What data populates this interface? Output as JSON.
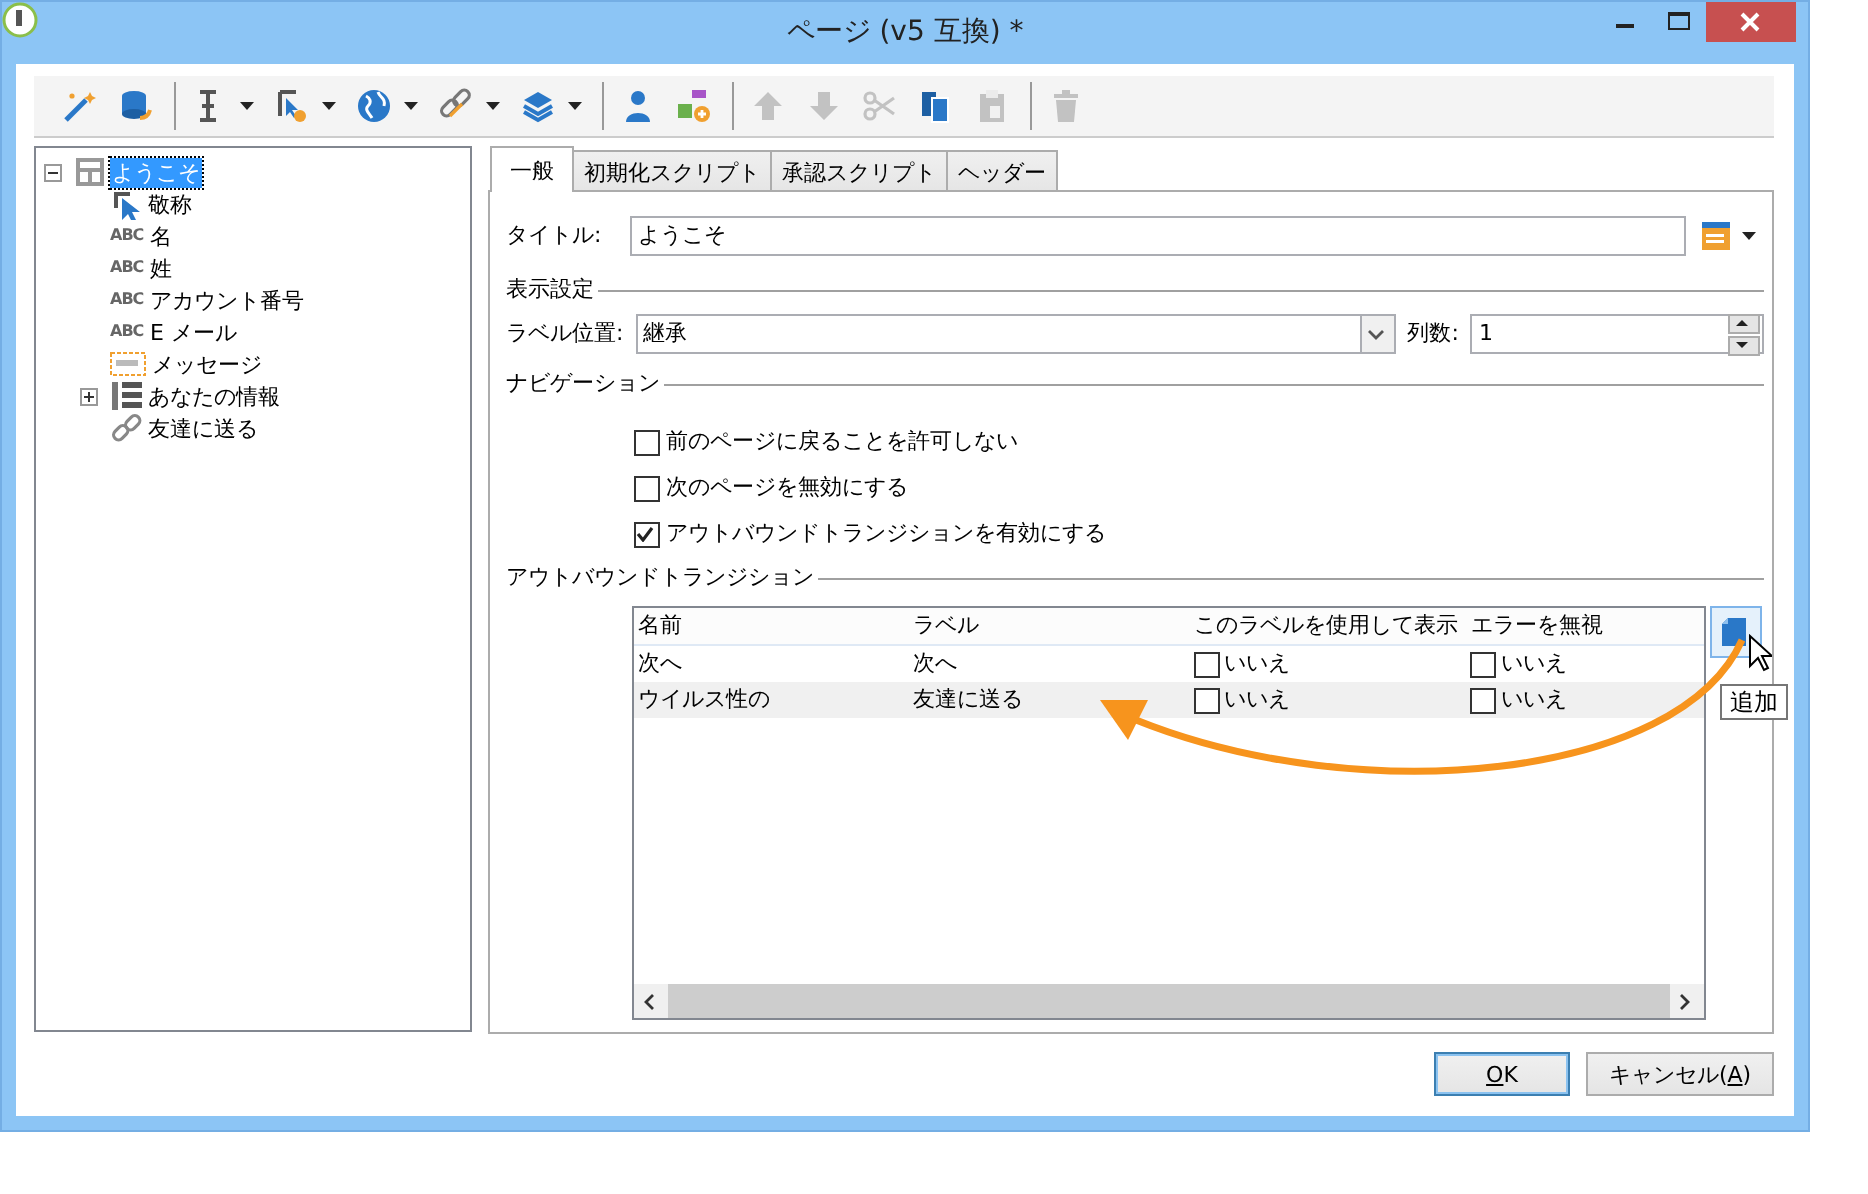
{
  "window": {
    "title": "ページ (v5 互換) *"
  },
  "toolbar": {
    "groups": [
      [
        {
          "dropdown": false,
          "disabled": false
        },
        {
          "dropdown": false,
          "disabled": false
        }
      ],
      [
        {
          "dropdown": true,
          "disabled": false
        },
        {
          "dropdown": true,
          "disabled": false
        },
        {
          "dropdown": true,
          "disabled": false
        },
        {
          "dropdown": true,
          "disabled": false
        },
        {
          "dropdown": true,
          "disabled": false
        }
      ],
      [
        {
          "dropdown": false,
          "disabled": false
        },
        {
          "dropdown": false,
          "disabled": false
        }
      ],
      [
        {
          "dropdown": false,
          "disabled": true
        },
        {
          "dropdown": false,
          "disabled": true
        },
        {
          "dropdown": false,
          "disabled": true
        },
        {
          "dropdown": false,
          "disabled": false
        },
        {
          "dropdown": false,
          "disabled": true
        }
      ],
      [
        {
          "dropdown": false,
          "disabled": true
        }
      ]
    ]
  },
  "tree": [
    {
      "label": "ようこそ",
      "kind": "page",
      "expanded": true,
      "selected": true,
      "children": [
        {
          "label": "敬称",
          "kind": "pointer",
          "selected": false
        },
        {
          "label": "名",
          "kind": "text",
          "badge": "ABC",
          "selected": false
        },
        {
          "label": "姓",
          "kind": "text",
          "badge": "ABC",
          "selected": false
        },
        {
          "label": "アカウント番号",
          "kind": "text",
          "badge": "ABC",
          "selected": false
        },
        {
          "label": "E メール",
          "kind": "text",
          "badge": "ABC",
          "selected": false
        },
        {
          "label": "メッセージ",
          "kind": "message",
          "selected": false
        },
        {
          "label": "あなたの情報",
          "kind": "group",
          "expanded": false,
          "selected": false
        },
        {
          "label": "友達に送る",
          "kind": "link",
          "selected": false
        }
      ]
    }
  ],
  "tabs": [
    {
      "label": "一般",
      "selected": true
    },
    {
      "label": "初期化スクリプト",
      "selected": false
    },
    {
      "label": "承認スクリプト",
      "selected": false
    },
    {
      "label": "ヘッダー",
      "selected": false
    }
  ],
  "form": {
    "title_label": "タイトル:",
    "title_value": "ようこそ",
    "display_section": "表示設定",
    "label_position_label": "ラベル位置:",
    "label_position_value": "継承",
    "columns_label": "列数:",
    "columns_value": "1",
    "navigation_section": "ナビゲーション",
    "checkboxes": [
      {
        "label": "前のページに戻ることを許可しない",
        "checked": false
      },
      {
        "label": "次のページを無効にする",
        "checked": false
      },
      {
        "label": "アウトバウンドトランジションを有効にする",
        "checked": true
      }
    ],
    "transitions_section": "アウトバウンドトランジション"
  },
  "table": {
    "columns": [
      "名前",
      "ラベル",
      "このラベルを使用して表示",
      "エラーを無視"
    ],
    "rows": [
      {
        "selected": false,
        "name": "次へ",
        "label": "次へ",
        "show": {
          "checked": false,
          "text": "いいえ"
        },
        "ignore": {
          "checked": false,
          "text": "いいえ"
        }
      },
      {
        "selected": true,
        "name": "ウイルス性の",
        "label": "友達に送る",
        "show": {
          "checked": false,
          "text": "いいえ"
        },
        "ignore": {
          "checked": false,
          "text": "いいえ"
        }
      }
    ]
  },
  "tooltip": "追加",
  "buttons": [
    {
      "access_key": "O",
      "label_end": "K",
      "default": true
    },
    {
      "label_start": "キャンセル(",
      "access_key": "A",
      "label_end": ")",
      "default": false
    }
  ]
}
